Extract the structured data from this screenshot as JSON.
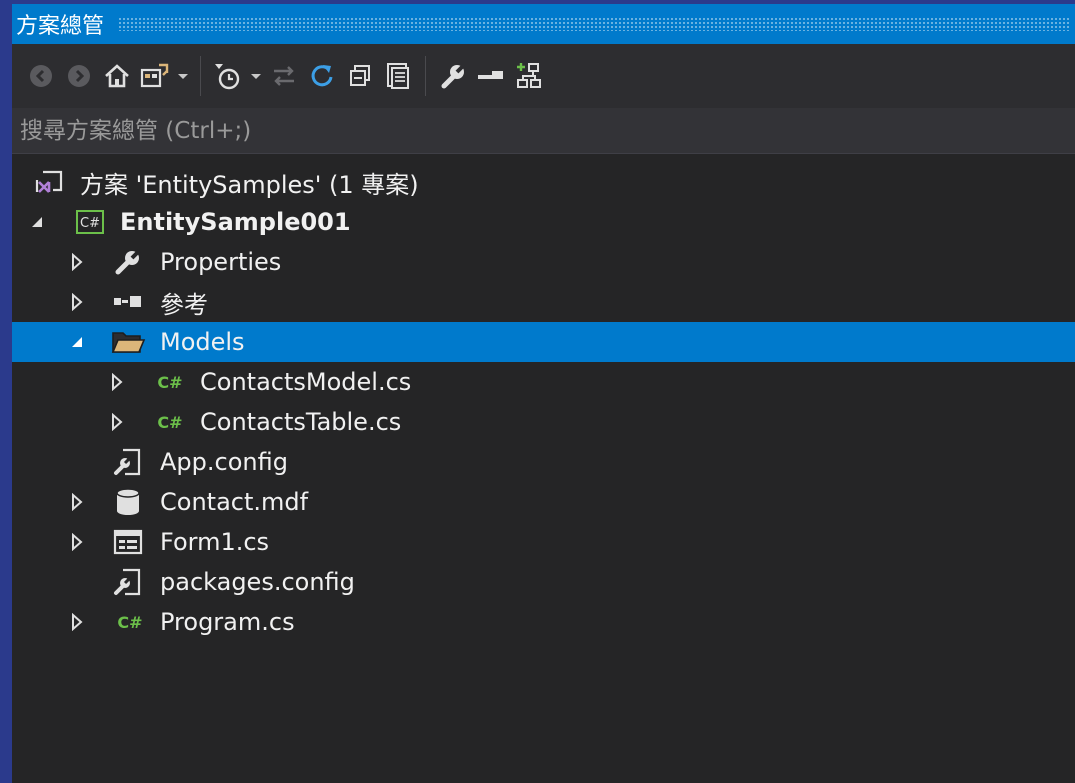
{
  "window": {
    "title": "方案總管"
  },
  "search": {
    "placeholder": "搜尋方案總管 (Ctrl+;)"
  },
  "tree": {
    "solution": "方案 'EntitySamples' (1 專案)",
    "project": "EntitySample001",
    "properties": "Properties",
    "references": "參考",
    "models": "Models",
    "contacts_model": "ContactsModel.cs",
    "contacts_table": "ContactsTable.cs",
    "app_config": "App.config",
    "contact_mdf": "Contact.mdf",
    "form1": "Form1.cs",
    "packages_config": "packages.config",
    "program": "Program.cs"
  },
  "colors": {
    "accent": "#007acc",
    "background": "#252526",
    "csharp_green": "#6cc04a",
    "folder": "#dcb67a"
  }
}
